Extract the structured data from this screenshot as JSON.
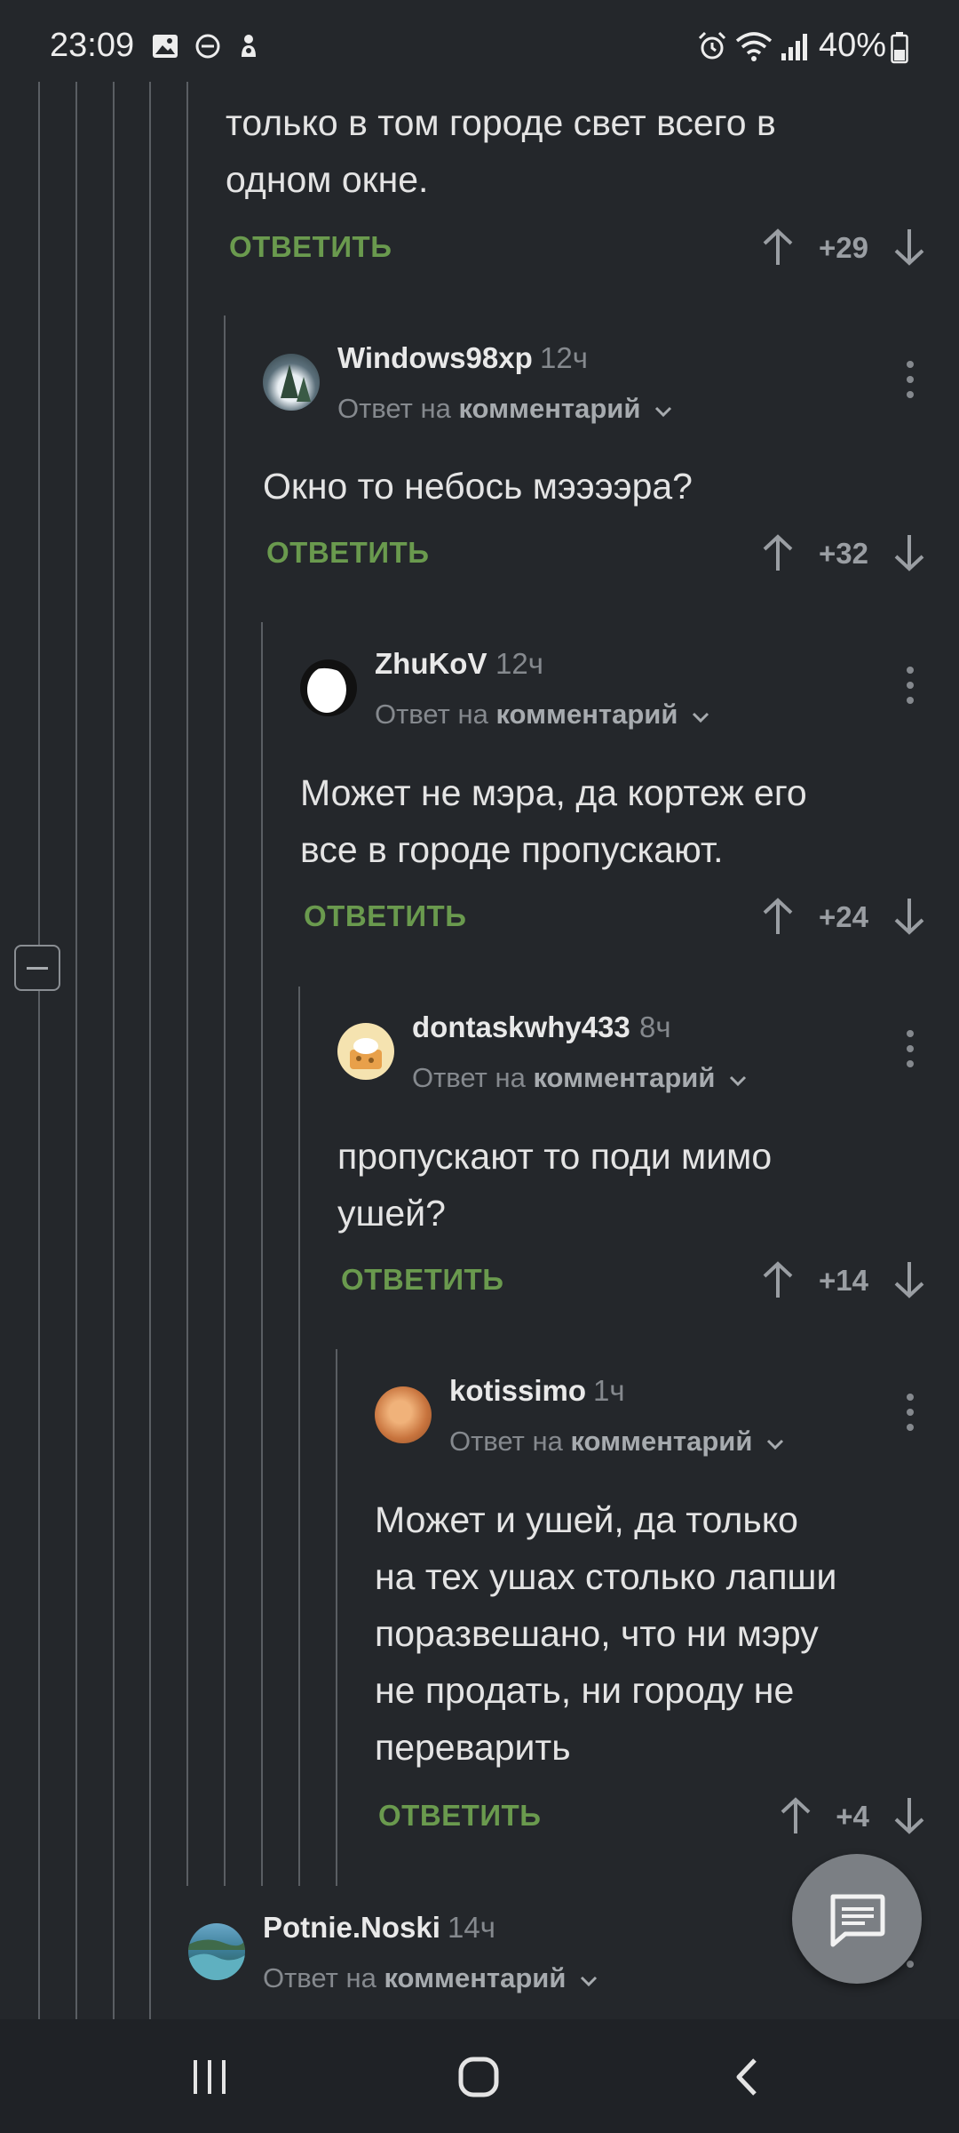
{
  "status_bar": {
    "time": "23:09",
    "battery": "40%",
    "icons": [
      "gallery-icon",
      "dnd-icon",
      "app-icon",
      "alarm-icon",
      "wifi-icon",
      "signal-icon",
      "battery-icon"
    ]
  },
  "comments": [
    {
      "lines": [
        "только в том городе свет всего в",
        "одном окне."
      ],
      "reply": "ОТВЕТИТЬ",
      "score": "+29"
    },
    {
      "author": "Windows98xp",
      "time": "12ч",
      "meta_prefix": "Ответ на",
      "meta_link": "комментарий",
      "lines": [
        "Окно то небось мээээра?"
      ],
      "reply": "ОТВЕТИТЬ",
      "score": "+32"
    },
    {
      "author": "ZhuKoV",
      "time": "12ч",
      "meta_prefix": "Ответ на",
      "meta_link": "комментарий",
      "lines": [
        "Может не мэра, да кортеж его",
        "все в городе пропускают."
      ],
      "reply": "ОТВЕТИТЬ",
      "score": "+24"
    },
    {
      "author": "dontaskwhy433",
      "time": "8ч",
      "meta_prefix": "Ответ на",
      "meta_link": "комментарий",
      "lines": [
        "пропускают то поди мимо",
        "ушей?"
      ],
      "reply": "ОТВЕТИТЬ",
      "score": "+14"
    },
    {
      "author": "kotissimo",
      "time": "1ч",
      "meta_prefix": "Ответ на",
      "meta_link": "комментарий",
      "lines": [
        "Может и ушей, да только",
        "на тех ушах столько лапши",
        "поразвешано, что ни мэру",
        "не продать, ни городу не",
        "переварить"
      ],
      "reply": "ОТВЕТИТЬ",
      "score": "+4"
    },
    {
      "author": "Potnie.Noski",
      "time": "14ч",
      "meta_prefix": "Ответ на",
      "meta_link": "комментарий"
    }
  ],
  "colors": {
    "background": "#24272b",
    "reply_green": "#6a9a4e",
    "muted": "#85898e"
  }
}
